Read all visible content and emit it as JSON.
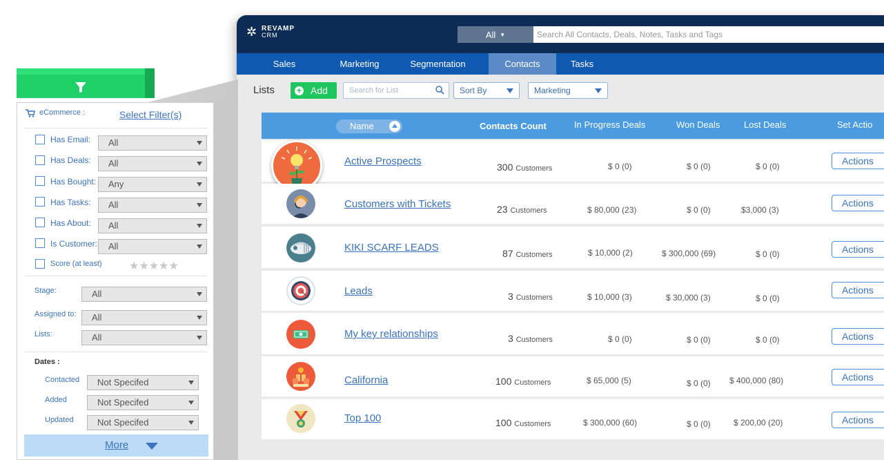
{
  "app": {
    "logo_line1": "REVAMP",
    "logo_line2": "CRM",
    "search_scope": "All",
    "search_placeholder": "Search All Contacts, Deals, Notes, Tasks and Tags",
    "nav_tabs": [
      {
        "label": "Sales",
        "active": false
      },
      {
        "label": "Marketing",
        "active": false
      },
      {
        "label": "Segmentation",
        "active": false
      },
      {
        "label": "Contacts",
        "active": true
      },
      {
        "label": "Tasks",
        "active": false
      }
    ],
    "colors": {
      "topbar": "#0c2c55",
      "navbar": "#0f5ab0",
      "nav_active": "#5b8ac6",
      "header": "#4a9be0",
      "add_green": "#1fc55e",
      "link_blue": "#3a73bd"
    }
  },
  "toolbar": {
    "lists_label": "Lists",
    "add_label": "Add",
    "search_placeholder": "Search for List",
    "sort_label": "Sort By",
    "segment_label": "Marketing"
  },
  "table": {
    "headers": {
      "name": "Name",
      "contacts_count": "Contacts Count",
      "in_progress": "In Progress Deals",
      "won": "Won Deals",
      "lost": "Lost Deals",
      "set_action": "Set Actio"
    },
    "rows": [
      {
        "icon": "lightbulb-plant-icon",
        "name": "Active Prospects",
        "count": "300",
        "unit": "Customers",
        "in_progress": "$ 0 (0)",
        "won": "$ 0 (0)",
        "lost": "$ 0 (0)",
        "action": "Actions"
      },
      {
        "icon": "support-agent-icon",
        "name": "Customers with Tickets",
        "count": "23",
        "unit": "Customers",
        "in_progress": "$ 80,000 (23)",
        "won": "$ 0 (0)",
        "lost": "$3,000 (3)",
        "action": "Actions"
      },
      {
        "icon": "scarf-icon",
        "name": "KIKI SCARF LEADS",
        "count": "87",
        "unit": "Customers",
        "in_progress": "$ 10,000 (2)",
        "won": "$ 300,000 (69)",
        "lost": "$ 0 (0)",
        "action": "Actions"
      },
      {
        "icon": "target-icon",
        "name": "Leads",
        "count": "3",
        "unit": "Customers",
        "in_progress": "$ 10,000 (3)",
        "won": "$ 30,000 (3)",
        "lost": "$ 0 (0)",
        "action": "Actions"
      },
      {
        "icon": "money-icon",
        "name": "My key relationships",
        "count": "3",
        "unit": "Customers",
        "in_progress": "$ 0 (0)",
        "won": "$ 0 (0)",
        "lost": "$ 0 (0)",
        "action": "Actions"
      },
      {
        "icon": "gifts-icon",
        "name": "California ",
        "count": "100",
        "unit": "Customers",
        "in_progress": "$ 65,000 (5)",
        "won": "$ 0 (0)",
        "lost": "$ 400,000 (80)",
        "action": "Actions"
      },
      {
        "icon": "medal-icon",
        "name": "Top 100",
        "count": "100",
        "unit": "Customers",
        "in_progress": "$ 300,000 (60)",
        "won": "$ 0 (0)",
        "lost": "$ 200,00 (20)",
        "action": "Actions"
      }
    ]
  },
  "filters": {
    "ecommerce_label": "eCommerce :",
    "select_filters": "Select Filter(s)",
    "checks": [
      {
        "label": "Has Email:",
        "value": "All"
      },
      {
        "label": "Has Deals:",
        "value": "All"
      },
      {
        "label": "Has Bought:",
        "value": "Any"
      },
      {
        "label": "Has Tasks:",
        "value": "All"
      },
      {
        "label": "Has About:",
        "value": "All"
      },
      {
        "label": "Is Customer:",
        "value": "All"
      }
    ],
    "score_label": "Score (at least)",
    "score_value": 0,
    "stars": "★★★★★",
    "selects": [
      {
        "label": "Stage:",
        "value": "All"
      },
      {
        "label": "Assigned to:",
        "value": "All"
      },
      {
        "label": "Lists:",
        "value": "All"
      }
    ],
    "dates_label": "Dates :",
    "dates": [
      {
        "label": "Contacted",
        "value": "Not Specifed"
      },
      {
        "label": "Added",
        "value": "Not Specifed"
      },
      {
        "label": "Updated",
        "value": "Not Specifed"
      }
    ],
    "more_label": "More"
  }
}
